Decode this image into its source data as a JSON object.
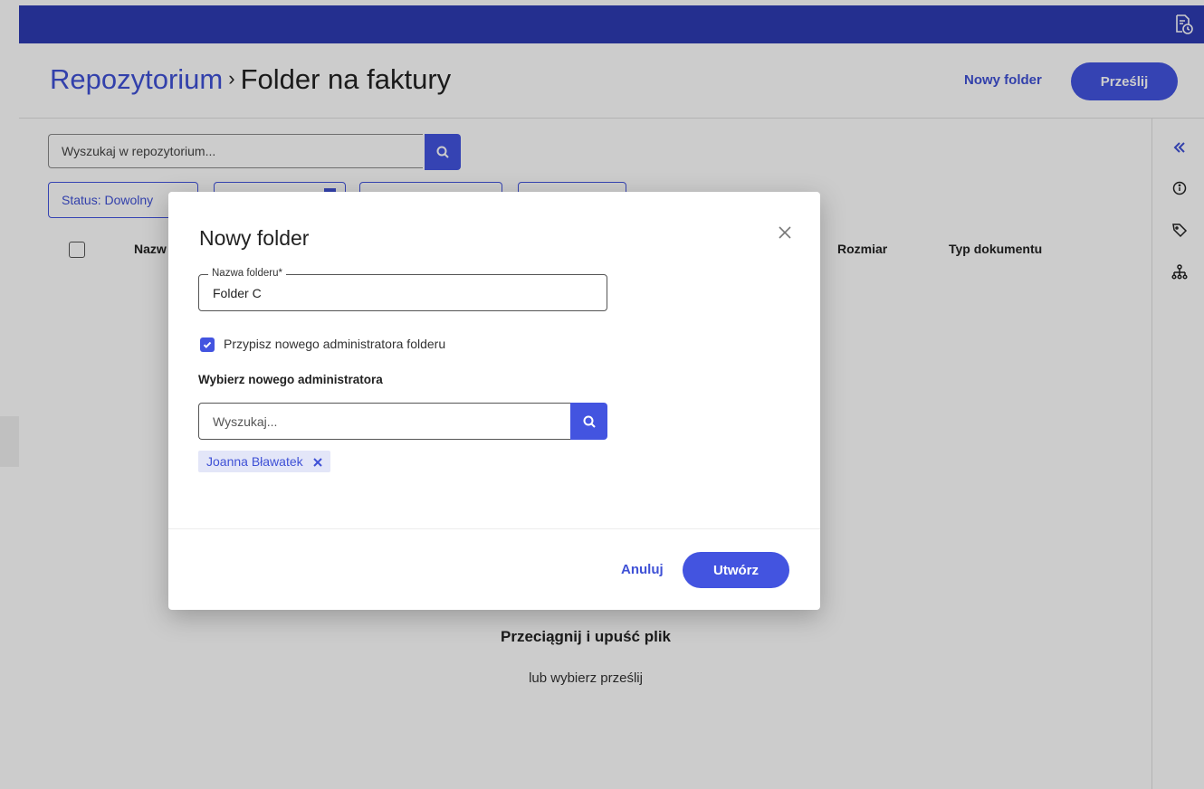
{
  "breadcrumb": {
    "root": "Repozytorium",
    "separator": "›",
    "current": "Folder na faktury"
  },
  "header": {
    "new_folder_label": "Nowy folder",
    "upload_label": "Prześlij"
  },
  "search": {
    "placeholder": "Wyszukaj w repozytorium..."
  },
  "filters": {
    "status": "Status: Dowolny"
  },
  "table": {
    "columns": [
      "Nazwa",
      "Rozmiar",
      "Typ dokumentu"
    ],
    "name_visible": "Nazw"
  },
  "dropzone": {
    "title": "Przeciągnij i upuść plik",
    "subtitle": "lub wybierz prześlij"
  },
  "modal": {
    "title": "Nowy folder",
    "folder_name_label": "Nazwa folderu*",
    "folder_name_value": "Folder C",
    "assign_admin_label": "Przypisz nowego administratora folderu",
    "assign_admin_checked": true,
    "select_admin_label": "Wybierz nowego administratora",
    "admin_search_placeholder": "Wyszukaj...",
    "selected_admin": "Joanna Bławatek",
    "cancel_label": "Anuluj",
    "create_label": "Utwórz"
  },
  "colors": {
    "brand": "#2e3bb3",
    "accent": "#4354e0",
    "chip_bg": "#e3e6f8"
  },
  "icons": {
    "topbar": "document-clock-icon",
    "rightbar": [
      "double-chevron-left-icon",
      "info-icon",
      "tag-icon",
      "hierarchy-icon"
    ]
  }
}
